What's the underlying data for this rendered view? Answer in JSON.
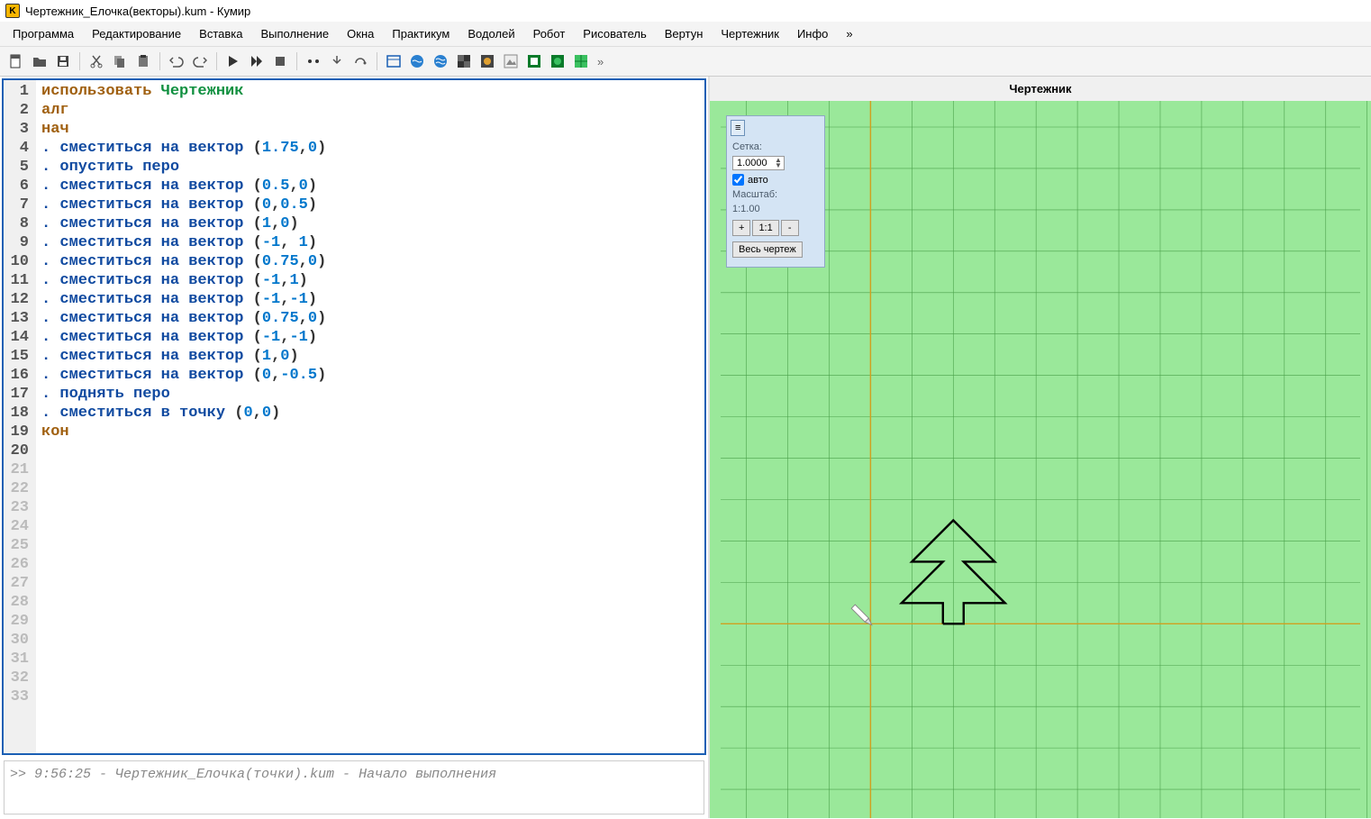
{
  "title": "Чертежник_Елочка(векторы).kum - Кумир",
  "menu": [
    "Программа",
    "Редактирование",
    "Вставка",
    "Выполнение",
    "Окна",
    "Практикум",
    "Водолей",
    "Робот",
    "Рисователь",
    "Вертун",
    "Чертежник",
    "Инфо",
    "»"
  ],
  "drawer_title": "Чертежник",
  "controls": {
    "grid_label": "Сетка:",
    "grid_value": "1.0000",
    "auto_label": "авто",
    "scale_label": "Масштаб:",
    "scale_value": "1:1.00",
    "plus": "+",
    "one_one": "1:1",
    "minus": "-",
    "fit": "Весь чертеж"
  },
  "code": {
    "lines": [
      {
        "t": "use",
        "kw": "использовать",
        "mod": "Чертежник"
      },
      {
        "t": "kw",
        "kw": "алг"
      },
      {
        "t": "kw",
        "kw": "нач"
      },
      {
        "t": "mov",
        "cmd": "сместиться на вектор",
        "a": "1.75",
        "b": "0"
      },
      {
        "t": "cmd",
        "cmd": "опустить перо"
      },
      {
        "t": "mov",
        "cmd": "сместиться на вектор",
        "a": "0.5",
        "b": "0"
      },
      {
        "t": "mov",
        "cmd": "сместиться на вектор",
        "a": "0",
        "b": "0.5"
      },
      {
        "t": "mov",
        "cmd": "сместиться на вектор",
        "a": "1",
        "b": "0"
      },
      {
        "t": "mov",
        "cmd": "сместиться на вектор",
        "a": "-1",
        "b": " 1"
      },
      {
        "t": "mov",
        "cmd": "сместиться на вектор",
        "a": "0.75",
        "b": "0"
      },
      {
        "t": "mov",
        "cmd": "сместиться на вектор",
        "a": "-1",
        "b": "1"
      },
      {
        "t": "mov",
        "cmd": "сместиться на вектор",
        "a": "-1",
        "b": "-1"
      },
      {
        "t": "mov",
        "cmd": "сместиться на вектор",
        "a": "0.75",
        "b": "0"
      },
      {
        "t": "mov",
        "cmd": "сместиться на вектор",
        "a": "-1",
        "b": "-1"
      },
      {
        "t": "mov",
        "cmd": "сместиться на вектор",
        "a": "1",
        "b": "0"
      },
      {
        "t": "mov",
        "cmd": "сместиться на вектор",
        "a": "0",
        "b": "-0.5"
      },
      {
        "t": "cmd",
        "cmd": "поднять перо"
      },
      {
        "t": "pt",
        "cmd": "сместиться в точку",
        "a": "0",
        "b": "0"
      },
      {
        "t": "kw",
        "kw": "кон"
      }
    ],
    "total_lines": 33
  },
  "console": ">>  9:56:25 - Чертежник_Елочка(точки).kum - Начало выполнения",
  "chart_data": {
    "type": "line",
    "title": "Чертежник",
    "grid_step": 1.0,
    "origin": [
      0,
      0
    ],
    "pen_path_vectors": [
      {
        "op": "moveTo",
        "x": 1.75,
        "y": 0
      },
      {
        "op": "penDown"
      },
      {
        "op": "rel",
        "dx": 0.5,
        "dy": 0
      },
      {
        "op": "rel",
        "dx": 0,
        "dy": 0.5
      },
      {
        "op": "rel",
        "dx": 1,
        "dy": 0
      },
      {
        "op": "rel",
        "dx": -1,
        "dy": 1
      },
      {
        "op": "rel",
        "dx": 0.75,
        "dy": 0
      },
      {
        "op": "rel",
        "dx": -1,
        "dy": 1
      },
      {
        "op": "rel",
        "dx": -1,
        "dy": -1
      },
      {
        "op": "rel",
        "dx": 0.75,
        "dy": 0
      },
      {
        "op": "rel",
        "dx": -1,
        "dy": -1
      },
      {
        "op": "rel",
        "dx": 1,
        "dy": 0
      },
      {
        "op": "rel",
        "dx": 0,
        "dy": -0.5
      },
      {
        "op": "penUp"
      },
      {
        "op": "moveTo",
        "x": 0,
        "y": 0
      }
    ]
  }
}
